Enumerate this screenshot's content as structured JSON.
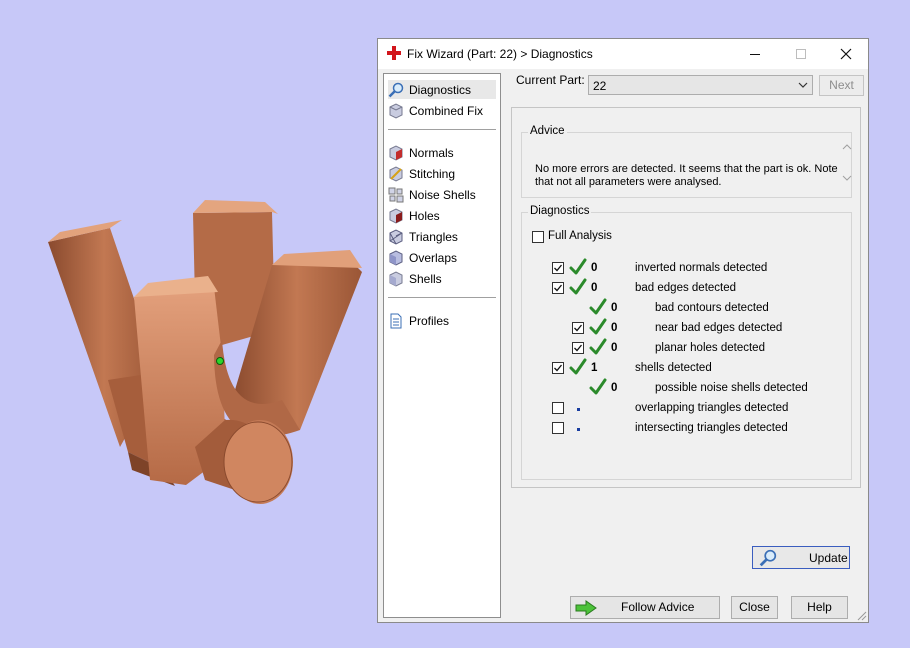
{
  "window": {
    "title": "Fix Wizard (Part: 22) > Diagnostics",
    "minimize": "minimize",
    "maximize": "maximize",
    "close": "close"
  },
  "nav": {
    "top_items": [
      {
        "label": "Diagnostics",
        "icon": "magnifier-icon",
        "selected": true
      },
      {
        "label": "Combined Fix",
        "icon": "cube-icon"
      }
    ],
    "tool_items": [
      {
        "label": "Normals",
        "icon": "normals-cube-icon"
      },
      {
        "label": "Stitching",
        "icon": "stitching-cube-icon"
      },
      {
        "label": "Noise Shells",
        "icon": "noise-shells-icon"
      },
      {
        "label": "Holes",
        "icon": "holes-cube-icon"
      },
      {
        "label": "Triangles",
        "icon": "triangles-cube-icon"
      },
      {
        "label": "Overlaps",
        "icon": "overlaps-cube-icon"
      },
      {
        "label": "Shells",
        "icon": "shells-cube-icon"
      }
    ],
    "bottom_items": [
      {
        "label": "Profiles",
        "icon": "document-icon"
      }
    ]
  },
  "current_part": {
    "label": "Current Part:",
    "value": "22",
    "next_label": "Next"
  },
  "advice": {
    "title": "Advice",
    "text": "No more errors are detected. It seems that the part is ok. Note that not all parameters were analysed."
  },
  "diagnostics": {
    "title": "Diagnostics",
    "full_analysis_label": "Full Analysis",
    "full_analysis_checked": false,
    "rows": [
      {
        "checked": true,
        "status": "check",
        "count": "0",
        "label": "inverted normals detected",
        "indent": 0
      },
      {
        "checked": true,
        "status": "check",
        "count": "0",
        "label": "bad edges detected",
        "indent": 0
      },
      {
        "checked": null,
        "status": "check",
        "count": "0",
        "label": "bad contours detected",
        "indent": 1
      },
      {
        "checked": true,
        "status": "check",
        "count": "0",
        "label": "near bad edges detected",
        "indent": 1
      },
      {
        "checked": true,
        "status": "check",
        "count": "0",
        "label": "planar holes detected",
        "indent": 1
      },
      {
        "checked": true,
        "status": "check",
        "count": "1",
        "label": "shells detected",
        "indent": 0
      },
      {
        "checked": null,
        "status": "check",
        "count": "0",
        "label": "possible noise shells detected",
        "indent": 1
      },
      {
        "checked": false,
        "status": "dot",
        "count": "",
        "label": "overlapping triangles detected",
        "indent": 0
      },
      {
        "checked": false,
        "status": "dot",
        "count": "",
        "label": "intersecting triangles detected",
        "indent": 0
      }
    ],
    "update_label": "Update"
  },
  "buttons": {
    "follow_advice": "Follow Advice",
    "close": "Close",
    "help": "Help"
  },
  "colors": {
    "viewport_bg": "#c7c8f8",
    "part_copper": "#c47a56",
    "check_green": "#2b8a2b",
    "app_logo_red": "#d2161c"
  }
}
